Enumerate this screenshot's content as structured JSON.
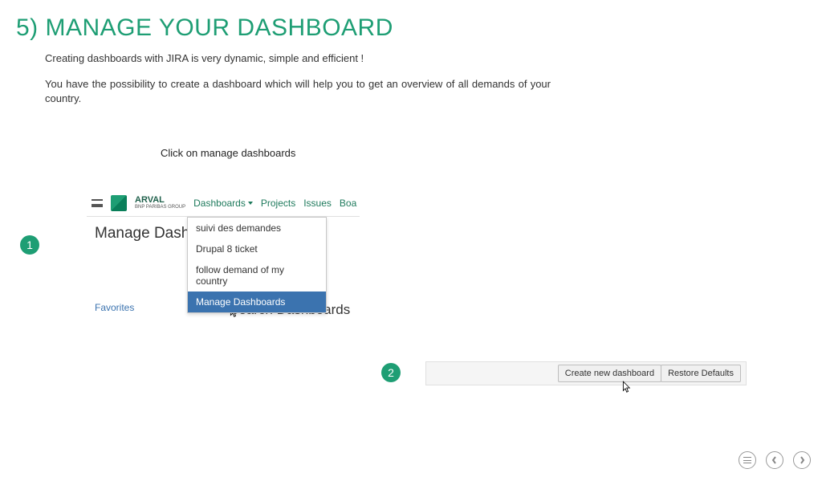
{
  "title": "5) MANAGE YOUR DASHBOARD",
  "intro": {
    "p1": "Creating dashboards with JIRA is very dynamic, simple and efficient !",
    "p2": "You have the possibility to create a dashboard which will help you to get an overview of all demands of your country."
  },
  "instruction": "Click on manage dashboards",
  "steps": {
    "one": "1",
    "two": "2"
  },
  "shot1": {
    "brand": "ARVAL",
    "brand_sub": "BNP PARIBAS GROUP",
    "nav": {
      "dashboards": "Dashboards",
      "projects": "Projects",
      "issues": "Issues",
      "boards": "Boa"
    },
    "page_title": "Manage Dashb",
    "dropdown": {
      "item1": "suivi des demandes",
      "item2": "Drupal 8 ticket",
      "item3": "follow demand of my country",
      "item4": "Manage Dashboards"
    },
    "favorites": "Favorites",
    "search_prefix": "S",
    "search_rest": "earch Dashboards"
  },
  "shot2": {
    "create": "Create new dashboard",
    "restore": "Restore Defaults"
  }
}
